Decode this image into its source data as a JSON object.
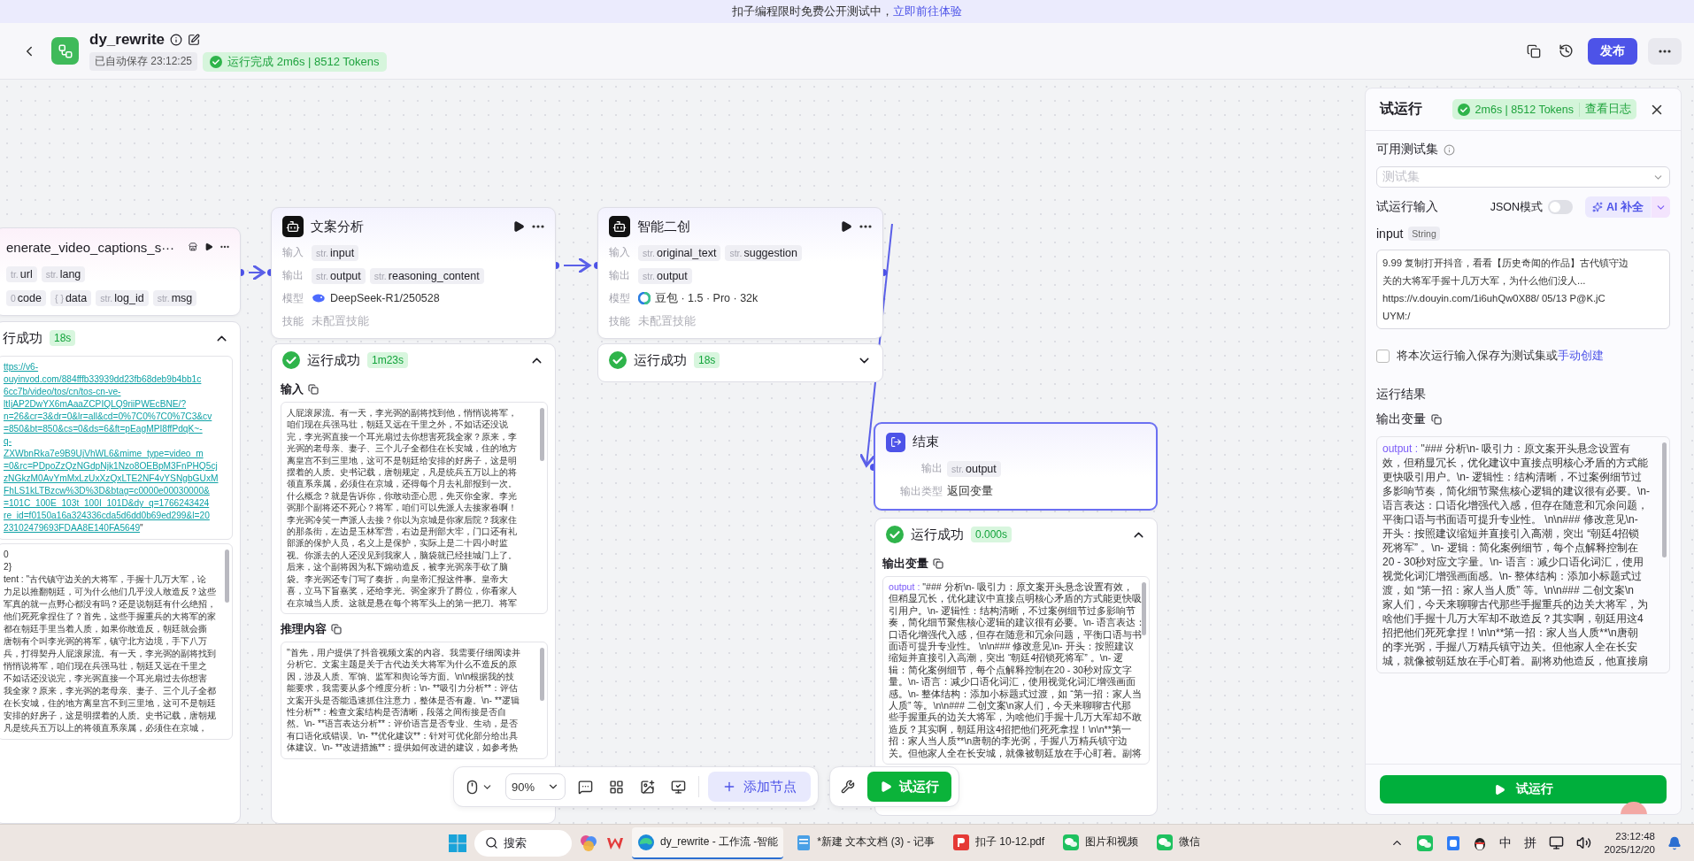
{
  "banner": {
    "text": "扣子编程限时免费公开测试中，",
    "link": "立即前往体验"
  },
  "header": {
    "title": "dy_rewrite",
    "autosave": "已自动保存 23:12:25",
    "status": "运行完成 2m6s | 8512 Tokens",
    "publish": "发布"
  },
  "nodes": [
    {
      "kind": "plugin",
      "title": "enerate_video_captions_s···",
      "selected": false,
      "rows": [
        {
          "kind": "tags",
          "tags": [
            {
              "type": "tr.",
              "name": "url"
            },
            {
              "type": "str.",
              "name": "lang"
            }
          ]
        },
        {
          "kind": "tags",
          "tags": [
            {
              "type": "0",
              "name": "code"
            },
            {
              "type": "{ }",
              "name": "data"
            },
            {
              "type": "str.",
              "name": "log_id"
            },
            {
              "type": "str.",
              "name": "msg"
            }
          ]
        }
      ],
      "result": {
        "status": "行成功",
        "time": "18s",
        "expanded": true,
        "sections": [
          {
            "kind": "link",
            "lines": [
              "ttps://v6-",
              "ouyinvod.com/884fffb33939dd23fb68deb9b4bb1c",
              "6cc7b/video/tos/cn/tos-cn-ve-",
              "ltIjAP2DwYX6mAaaZCPIQLQ9riiPWEcBNE/?",
              "n=26&cr=3&dr=0&lr=all&cd=0%7C0%7C0%7C3&cv",
              "=850&bt=850&cs=0&ds=6&ft=pEagMPI8ffPdqK~-",
              "q-",
              "ZXWbnRka7e9B9UjVhWL6&mime_type=video_m",
              "=0&rc=PDpoZzQzNGdpNjk1Nzo8OEBpM3FnPHQ5cj",
              "zNGkzM0AvYmMxLzUxXzQxLTE2NF4vYSNgbGUxM",
              "FhLS1kLTBzcw%3D%3D&btag=c0000e00030000&",
              "=101C_100E_103t_100I_101D&dy_q=1766243424",
              "re_id=f0150a16a324336cda5d6dd0b69ed299&l=20",
              "23102479693FDAA8E140FA5649"
            ],
            "tail": "\""
          },
          {
            "kind": "text",
            "lines": [
              "0",
              "2}",
              "tent : \"古代镇守边关的大将军，手握十几万大军，论",
              "力足以推翻朝廷，可为什么他们几乎没人敢造反？这些",
              "军真的就一点野心都没有吗？还是说朝廷有什么绝招，",
              "他们死死拿捏住了？首先，这些手握重兵的大将军的家",
              "都在朝廷手里当着人质，如果你敢造反，朝廷就会撕",
              "唐朝有个叫李光弼的将军，镇守北方边境，手下八万",
              "兵，打得契丹人屁滚尿流。有一天，李光弼的副将找到",
              "悄悄说将军，咱们现在兵强马壮，朝廷又远在千里之",
              "不如话还没说完，李光弼直接一个耳光扇过去你想害",
              "我全家？原来，李光弼的老母亲、妻子、三个儿子全都",
              "在长安城，住的地方离皇宫不到三里地，这可不是朝廷",
              "安排的好房子，这是明摆着的人质。史书记载，唐朝规",
              "凡是统兵五万以上的将领直系亲属，必须住在京城，"
            ]
          }
        ]
      }
    },
    {
      "kind": "llm",
      "title": "文案分析",
      "selected": false,
      "rows": [
        {
          "kind": "tags",
          "label": "输入",
          "tags": [
            {
              "type": "str.",
              "name": "input"
            }
          ]
        },
        {
          "kind": "tags",
          "label": "输出",
          "tags": [
            {
              "type": "str.",
              "name": "output"
            },
            {
              "type": "str.",
              "name": "reasoning_content"
            }
          ]
        },
        {
          "kind": "model",
          "label": "模型",
          "text": "DeepSeek-R1/250528"
        },
        {
          "kind": "muted",
          "label": "技能",
          "text": "未配置技能"
        }
      ],
      "result": {
        "status": "运行成功",
        "time": "1m23s",
        "expanded": true,
        "sections": [
          {
            "kind": "text",
            "label": "输入",
            "lines": [
              "人屁滚尿流。有一天，李光弼的副将找到他，悄悄说将军，",
              "咱们现在兵强马壮，朝廷又远在千里之外，不如话还没说",
              "完，李光弼直接一个耳光扇过去你想害死我全家？原来，李",
              "光弼的老母亲、妻子、三个儿子全都住在长安城，住的地方",
              "离皇宫不到三里地，这可不是朝廷给安排的好房子，这是明",
              "摆着的人质。史书记载，唐朝规定，凡是统兵五万以上的将",
              "领直系亲属，必须住在京城，还得每个月去礼部报到一次。",
              "什么概念？就是告诉你，你敢动歪心思，先灭你全家。李光",
              "弼那个副将还不死心？将军，咱们可以先派人去接家眷啊！",
              "李光弼冷笑一声派人去接？你以为京城是你家后院？我家住",
              "的那条街，左边是玉林军营，右边是刑部大牢，门口还有礼",
              "部派的保护人员，名义上是保护，实际上是二十四小时监",
              "视。你派去的人还没见到我家人，脑袋就已经挂城门上了。",
              "后来，这个副将因为私下煽动造反，被李光弼亲手砍了脑",
              "袋。李光弼还专门写了奏折，向皇帝汇报这件事。皇帝大",
              "喜，立马下旨嘉奖，还给李光。弼全家升了爵位，你看家人",
              "在京城当人质。这就是悬在每个将军头上的第一把刀。将军"
            ]
          },
          {
            "kind": "text",
            "label": "推理内容",
            "lines": [
              "\"首先，用户提供了抖音视频文案的内容。我需要仔细阅读并",
              "分析它。文案主题是关于古代边关大将军为什么不造反的原",
              "因，涉及人质、军饷、监军和舆论等方面。\\n\\n根据我的技",
              "能要求，我需要从多个维度分析：\\n- **吸引力分析**：评估",
              "文案开头是否能迅速抓住注意力，整体是否有趣。\\n- **逻辑",
              "性分析**：检查文案结构是否清晰，段落之间衔接是否自",
              "然。\\n- **语言表达分析**：评价语言是否专业、生动，是否",
              "有口语化或错误。\\n- **优化建议**：针对可优化部分给出具",
              "体建议。\\n- **改进措施**：提供如何改进的建议，如参考热"
            ]
          }
        ]
      }
    },
    {
      "kind": "llm",
      "title": "智能二创",
      "selected": false,
      "rows": [
        {
          "kind": "tags",
          "label": "输入",
          "tags": [
            {
              "type": "str.",
              "name": "original_text"
            },
            {
              "type": "str.",
              "name": "suggestion"
            }
          ]
        },
        {
          "kind": "tags",
          "label": "输出",
          "tags": [
            {
              "type": "str.",
              "name": "output"
            }
          ]
        },
        {
          "kind": "model",
          "label": "模型",
          "text": "豆包 · 1.5 · Pro · 32k"
        },
        {
          "kind": "muted",
          "label": "技能",
          "text": "未配置技能"
        }
      ],
      "result": {
        "status": "运行成功",
        "time": "18s",
        "expanded": false
      }
    },
    {
      "kind": "end",
      "title": "结束",
      "selected": true,
      "rows": [
        {
          "kind": "tags",
          "label": "输出",
          "tags": [
            {
              "type": "str.",
              "name": "output"
            }
          ]
        },
        {
          "kind": "text",
          "label": "输出类型",
          "text": "返回变量"
        }
      ],
      "result": {
        "status": "运行成功",
        "time": "0.000s",
        "expanded": true,
        "sections": [
          {
            "kind": "text",
            "label": "输出变量",
            "key": "output : ",
            "lines": [
              "\"### 分析\\n- 吸引力：原文案开头悬念设置有效，",
              "但稍显冗长，优化建议中直接点明核心矛盾的方式能更快吸",
              "引用户。\\n- 逻辑性：结构清晰，不过案例细节过多影响节",
              "奏，简化细节聚焦核心逻辑的建议很有必要。\\n- 语言表达：",
              "口语化增强代入感，但存在随意和冗余问题，平衡口语与书",
              "面语可提升专业性。 \\n\\n### 修改意见\\n- 开头：按照建议",
              "缩短并直接引入高潮，突出 “朝廷4招锁死将军” 。\\n- 逻",
              "辑：简化案例细节，每个点解释控制在20 - 30秒对应文字",
              "量。\\n- 语言：减少口语化词汇，使用视觉化词汇增强画面",
              "感。\\n- 整体结构：添加小标题式过渡，如 “第一招：家人当",
              "人质” 等。\\n\\n### 二创文案\\n家人们，今天来聊聊古代那",
              "些手握重兵的边关大将军，为啥他们手握十几万大军却不敢",
              "造反？其实啊，朝廷用这4招把他们死死拿捏！\\n\\n**第一",
              "招：家人当人质**\\n唐朝的李光弼，手握八万精兵镇守边",
              "关。但他家人全在长安城，就像被朝廷放在手心盯着。副将"
            ]
          }
        ]
      }
    }
  ],
  "toolbar": {
    "zoom": "90%",
    "add_node": "添加节点",
    "run": "试运行"
  },
  "panel": {
    "title": "试运行",
    "badge": "2m6s | 8512 Tokens",
    "log_link": "查看日志",
    "testset_label": "可用测试集",
    "testset_placeholder": "测试集",
    "input_label": "试运行输入",
    "json_mode": {
      "label": "JSON模式",
      "on": false
    },
    "ai_button": "AI 补全",
    "field": {
      "name": "input",
      "type": "String",
      "lines": [
        "9.99 复制打开抖音，看看【历史奇闻的作品】古代镇守边",
        "关的大将军手握十几万大军，为什么他们没人...",
        "https://v.douyin.com/1i6uhQw0X88/ 05/13 P@K.jC",
        "UYM:/"
      ]
    },
    "save": {
      "checked": false,
      "text": "将本次运行输入保存为测试集或",
      "link": "手动创建"
    },
    "results_label": "运行结果",
    "output_label": "输出变量",
    "output": {
      "key": "output : ",
      "lines": [
        "\"### 分析\\n- 吸引力：原文案开头悬念设置有",
        "效，但稍显冗长，优化建议中直接点明核心矛盾的方式能",
        "更快吸引用户。\\n- 逻辑性：结构清晰，不过案例细节过",
        "多影响节奏，简化细节聚焦核心逻辑的建议很有必要。\\n-",
        "语言表达：口语化增强代入感，但存在随意和冗余问题，",
        "平衡口语与书面语可提升专业性。 \\n\\n### 修改意见\\n-",
        "开头：按照建议缩短并直接引入高潮，突出 “朝廷4招锁",
        "死将军” 。\\n- 逻辑：简化案例细节，每个点解释控制在",
        "20 - 30秒对应文字量。\\n- 语言：减少口语化词汇，使用",
        "视觉化词汇增强画面感。\\n- 整体结构：添加小标题式过",
        "渡，如 “第一招：家人当人质” 等。\\n\\n### 二创文案\\n",
        "家人们，今天来聊聊古代那些手握重兵的边关大将军，为",
        "啥他们手握十几万大军却不敢造反？其实啊，朝廷用这4",
        "招把他们死死拿捏！\\n\\n**第一招：家人当人质**\\n唐朝",
        "的李光弼，手握八万精兵镇守边关。但他家人全在长安",
        "城，就像被朝廷放在手心盯着。副将劝他造反，他直接扇"
      ]
    },
    "run_button": "试运行"
  },
  "taskbar": {
    "search": "搜索",
    "apps": [
      {
        "kind": "edge",
        "label": "dy_rewrite - 工作流 -智能",
        "selected": true
      },
      {
        "kind": "notepad",
        "label": "*新建 文本文档 (3) - 记事",
        "selected": false
      },
      {
        "kind": "pdf",
        "label": "扣子 10-12.pdf",
        "selected": false
      },
      {
        "kind": "photos",
        "label": "图片和视频",
        "selected": false
      },
      {
        "kind": "wechat",
        "label": "微信",
        "selected": false
      }
    ],
    "ime": [
      "中",
      "拼"
    ],
    "time": "23:12:48",
    "date": "2025/12/20"
  }
}
